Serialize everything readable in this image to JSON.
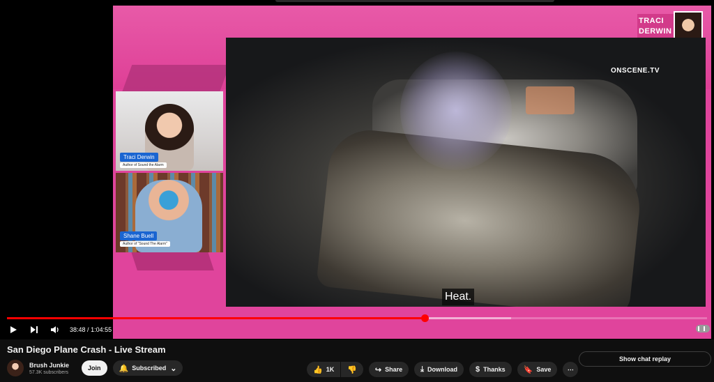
{
  "player": {
    "watermark": "ONSCENE.TV",
    "caption": "Heat.",
    "brand_line1": "TRACI",
    "brand_line2": "DERWIN",
    "guests": [
      {
        "name": "Traci Derwin",
        "role": "Author of Sound the Alarm"
      },
      {
        "name": "Shane Buell",
        "role": "Author of \"Sound The Alarm\""
      }
    ],
    "time_current": "38:48",
    "time_separator": "/",
    "time_total": "1:04:55",
    "progress_fraction": 0.597,
    "buffered_fraction": 0.72
  },
  "video": {
    "title": "San Diego Plane Crash - Live Stream",
    "channel_name": "Brush Junkie",
    "subscribers": "57.3K subscribers",
    "join_label": "Join",
    "subscribed_label": "Subscribed",
    "like_count": "1K",
    "share_label": "Share",
    "download_label": "Download",
    "thanks_label": "Thanks",
    "save_label": "Save"
  },
  "chat": {
    "replay_label": "Show chat replay"
  },
  "icons": {
    "play": "play-icon",
    "next": "next-icon",
    "volume": "volume-icon",
    "bell": "bell-icon",
    "like": "thumbs-up-icon",
    "dislike": "thumbs-down-icon",
    "share": "share-icon",
    "download": "download-icon",
    "thanks": "thanks-icon",
    "save": "save-icon",
    "more": "more-icon"
  },
  "colors": {
    "progress": "#ff0000",
    "stage_pink": "#e0449c",
    "tag_blue": "#1a65d1"
  }
}
